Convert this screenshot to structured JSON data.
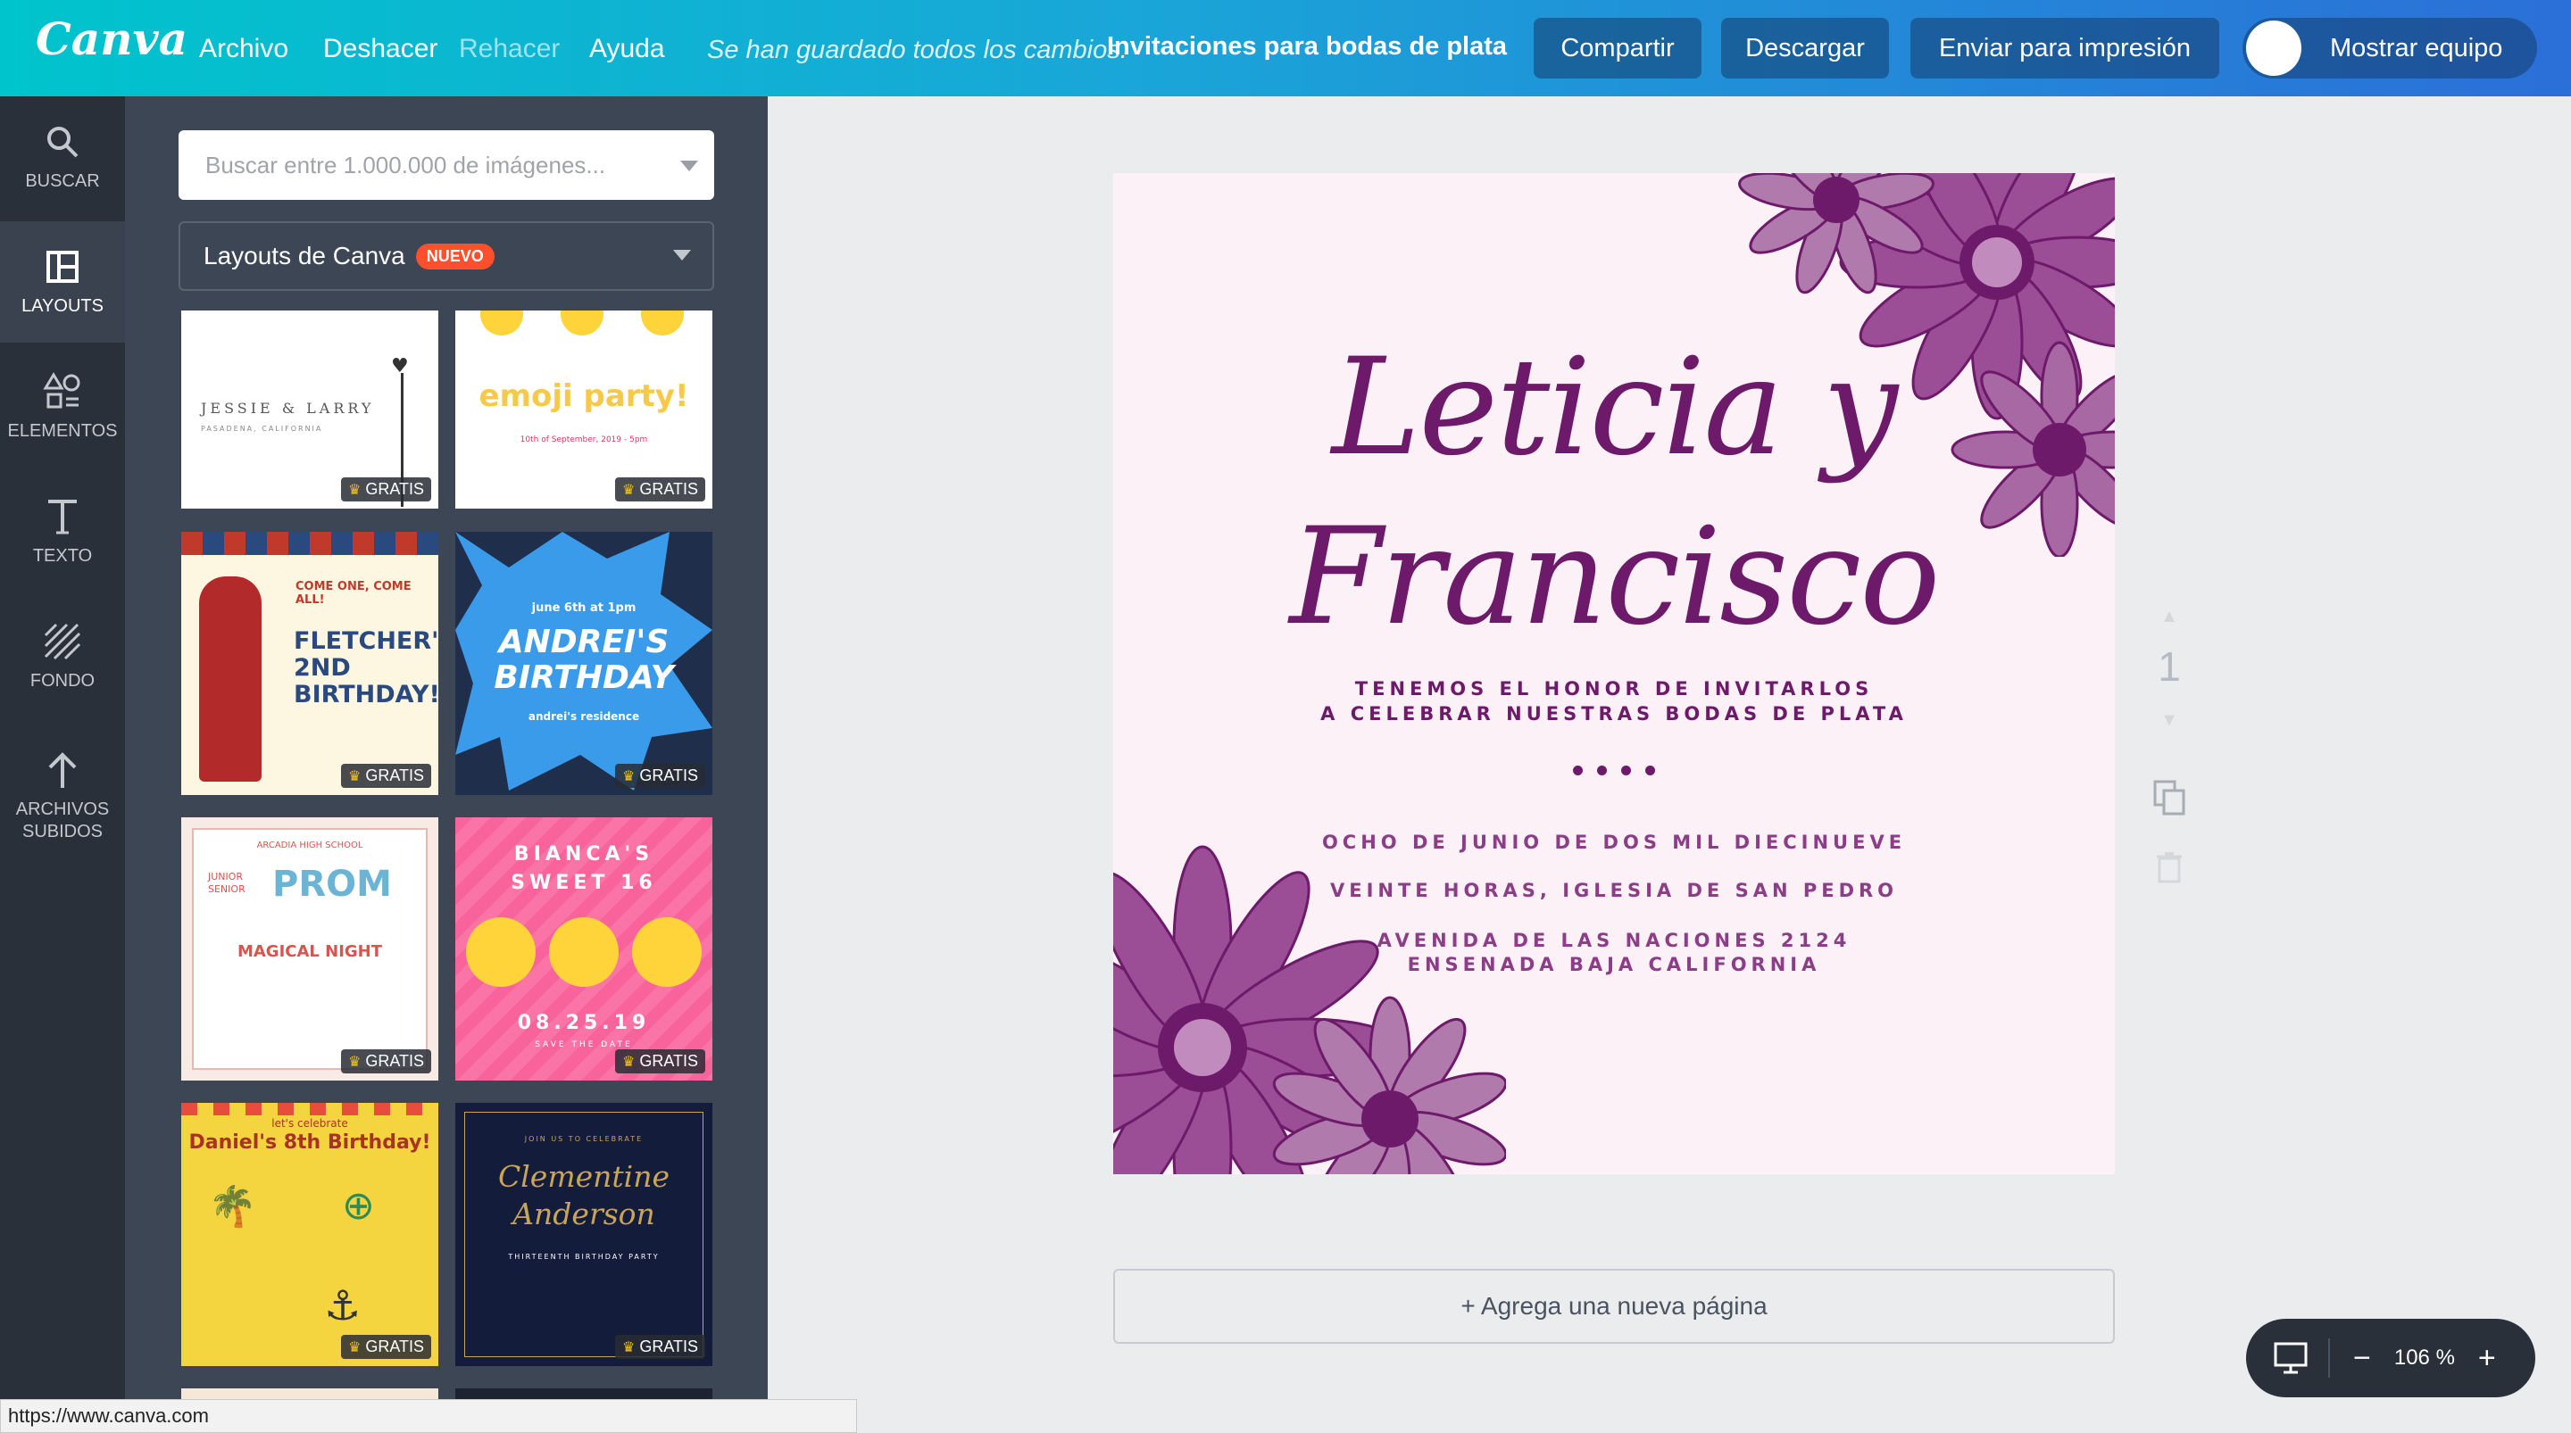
{
  "app": {
    "logo": "Canva"
  },
  "menu": {
    "file": "Archivo",
    "undo": "Deshacer",
    "redo": "Rehacer",
    "help": "Ayuda"
  },
  "header": {
    "saved_status": "Se han guardado todos los cambios.",
    "doc_title": "Invitaciones para bodas de plata",
    "share": "Compartir",
    "download": "Descargar",
    "print": "Enviar para impresión",
    "team": "Mostrar equipo"
  },
  "sidenav": [
    {
      "label": "BUSCAR",
      "icon": "search-icon"
    },
    {
      "label": "LAYOUTS",
      "icon": "layouts-icon"
    },
    {
      "label": "ELEMENTOS",
      "icon": "elements-icon"
    },
    {
      "label": "TEXTO",
      "icon": "text-icon"
    },
    {
      "label": "FONDO",
      "icon": "background-icon"
    },
    {
      "label": "ARCHIVOS",
      "label2": "SUBIDOS",
      "icon": "upload-icon"
    }
  ],
  "panel": {
    "search_placeholder": "Buscar entre 1.000.000 de imágenes...",
    "select_label": "Layouts de Canva",
    "select_badge": "NUEVO",
    "free_label": "GRATIS",
    "templates": [
      {
        "line1": "JESSIE & LARRY",
        "line2": "PASADENA, CALIFORNIA"
      },
      {
        "line1": "emoji party!",
        "line2": "10th of September, 2019 - 5pm"
      },
      {
        "line1": "COME ONE, COME ALL!",
        "line2": "FLETCHER'S",
        "line3": "2ND BIRTHDAY!"
      },
      {
        "line1": "june 6th at 1pm",
        "line2": "ANDREI'S",
        "line3": "BIRTHDAY",
        "line4": "andrei's residence"
      },
      {
        "line1": "ARCADIA HIGH SCHOOL",
        "line2": "JUNIOR SENIOR",
        "line3": "PROM",
        "line4": "MAGICAL NIGHT"
      },
      {
        "line1": "BIANCA'S",
        "line2": "SWEET 16",
        "line3": "08.25.19",
        "line4": "SAVE THE DATE"
      },
      {
        "line1": "let's celebrate",
        "line2": "Daniel's 8th Birthday!"
      },
      {
        "line1": "JOIN US TO CELEBRATE",
        "line2": "Clementine",
        "line3": "Anderson",
        "line4": "THIRTEENTH BIRTHDAY PARTY"
      }
    ]
  },
  "invitation": {
    "name1": "Leticia y",
    "name2": "Francisco",
    "line1": "TENEMOS EL HONOR DE INVITARLOS",
    "line2": "A CELEBRAR NUESTRAS BODAS DE PLATA",
    "date": "OCHO DE JUNIO DE DOS MIL DIECINUEVE",
    "time_place": "VEINTE HORAS,  IGLESIA DE SAN PEDRO",
    "address1": "AVENIDA DE LAS NACIONES 2124",
    "address2": "ENSENADA BAJA CALIFORNIA",
    "accent_color": "#6e1a6a"
  },
  "page_number": "1",
  "add_page": "+ Agrega una nueva página",
  "zoom": "106 %",
  "status_url": "https://www.canva.com"
}
